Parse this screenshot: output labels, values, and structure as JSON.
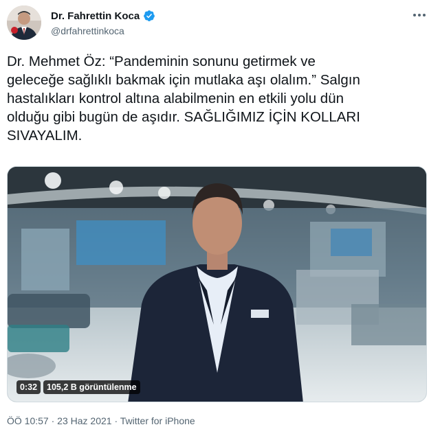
{
  "author": {
    "display_name": "Dr. Fahrettin Koca",
    "handle": "@drfahrettinkoca",
    "verified_icon": "verified-badge-icon",
    "verified_color": "#1d9bf0"
  },
  "tweet": {
    "text": "Dr. Mehmet Öz: “Pandeminin sonunu getirmek ve\ngeleceğe sağlıklı bakmak için mutlaka aşı olalım.” Salgın\nhastalıkları kontrol altına alabilmenin en etkili yolu dün\nolduğu gibi bugün de aşıdır. SAĞLIĞIMIZ İÇİN KOLLARI\nSIVAYALIM."
  },
  "video": {
    "duration": "0:32",
    "views": "105,2 B görüntülenme"
  },
  "meta": {
    "time": "ÖÖ 10:57",
    "separator": " · ",
    "date": "23 Haz 2021",
    "source": "Twitter for iPhone"
  },
  "colors": {
    "text": "#0f1419",
    "secondary": "#536471"
  }
}
